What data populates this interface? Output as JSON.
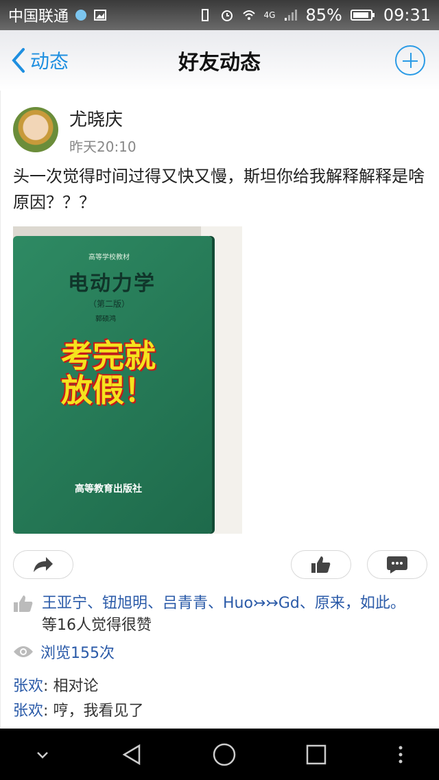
{
  "status_bar": {
    "carrier": "中国联通",
    "network": "4G",
    "battery": "85%",
    "time": "09:31"
  },
  "header": {
    "back_label": "动态",
    "title": "好友动态"
  },
  "post": {
    "author": "尤晓庆",
    "timestamp": "昨天20:10",
    "text": "头一次觉得时间过得又快又慢，斯坦你给我解释解释是啥原因？？？",
    "photo": {
      "book_series": "高等学校教材",
      "book_title": "电动力学",
      "book_edition": "（第二版）",
      "book_author": "郭硕鸿",
      "sticker_text": "考完就放假！",
      "book_publisher": "高等教育出版社"
    }
  },
  "likes": {
    "names": "王亚宁、钮旭明、吕青青、Huo↣↣Gd、原来，如此。",
    "suffix": "等16人觉得很赞"
  },
  "views": {
    "label": "浏览155次"
  },
  "comments": [
    {
      "author": "张欢",
      "text": "相对论"
    },
    {
      "author": "张欢",
      "text": "哼，我看见了"
    }
  ]
}
